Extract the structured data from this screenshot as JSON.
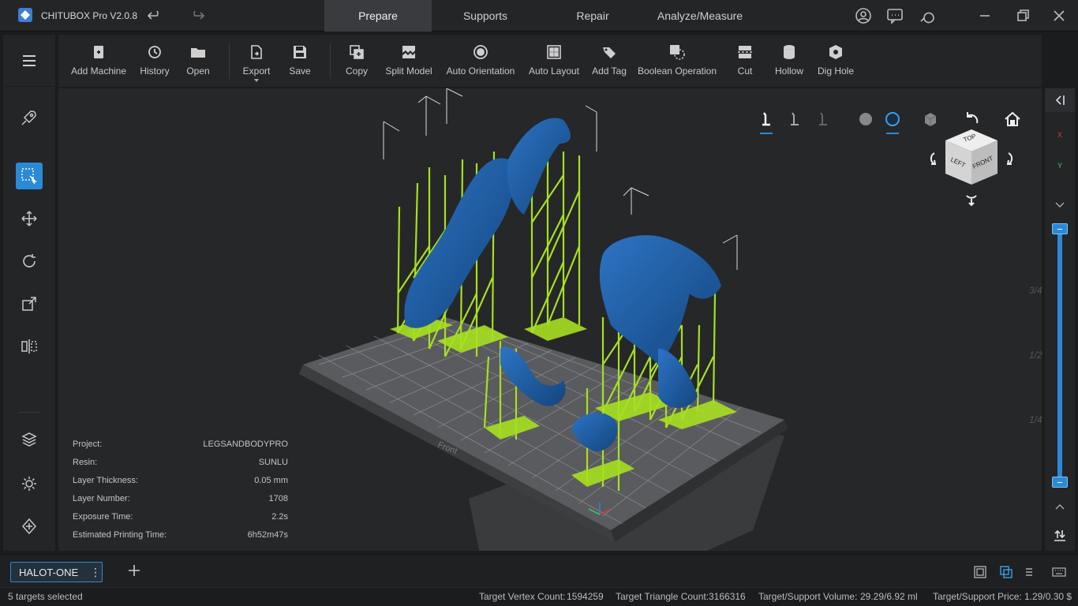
{
  "app": {
    "title": "CHITUBOX Pro V2.0.8"
  },
  "tabs": [
    {
      "label": "Prepare",
      "active": true
    },
    {
      "label": "Supports",
      "active": false
    },
    {
      "label": "Repair",
      "active": false
    },
    {
      "label": "Analyze/Measure",
      "active": false
    }
  ],
  "toolbar": [
    {
      "label": "Add Machine",
      "icon": "add-machine-icon"
    },
    {
      "label": "History",
      "icon": "history-icon"
    },
    {
      "label": "Open",
      "icon": "folder-icon"
    },
    {
      "label": "Export",
      "icon": "export-icon"
    },
    {
      "label": "Save",
      "icon": "save-icon"
    },
    {
      "label": "Copy",
      "icon": "copy-icon"
    },
    {
      "label": "Split Model",
      "icon": "split-model-icon"
    },
    {
      "label": "Auto Orientation",
      "icon": "auto-orientation-icon"
    },
    {
      "label": "Auto Layout",
      "icon": "auto-layout-icon"
    },
    {
      "label": "Add Tag",
      "icon": "tag-icon"
    },
    {
      "label": "Boolean Operation",
      "icon": "boolean-icon"
    },
    {
      "label": "Cut",
      "icon": "cut-icon"
    },
    {
      "label": "Hollow",
      "icon": "hollow-icon"
    },
    {
      "label": "Dig Hole",
      "icon": "dig-hole-icon"
    }
  ],
  "viewcube": {
    "top": "TOP",
    "left": "LEFT",
    "front": "FRONT"
  },
  "plate_label": "Front",
  "info": {
    "rows": [
      {
        "label": "Project:",
        "value": "LEGSANDBODYPRO"
      },
      {
        "label": "Resin:",
        "value": "SUNLU"
      },
      {
        "label": "Layer Thickness:",
        "value": "0.05 mm"
      },
      {
        "label": "Layer Number:",
        "value": "1708"
      },
      {
        "label": "Exposure Time:",
        "value": "2.2s"
      },
      {
        "label": "Estimated Printing Time:",
        "value": "6h52m47s"
      }
    ]
  },
  "right_rail": {
    "axis_x": "X",
    "axis_y": "Y",
    "ticks": [
      "3/4",
      "1/2",
      "1/4"
    ]
  },
  "machine_tab": {
    "label": "HALOT-ONE",
    "more": "⋮"
  },
  "status": {
    "selected": "5 targets selected",
    "vertex_label": "Target Vertex Count:",
    "vertex_value": "1594259",
    "triangle_label": "Target Triangle Count:",
    "triangle_value": "3166316",
    "volume_label": "Target/Support Volume:",
    "volume_value": "29.29/6.92 ml",
    "price_label": "Target/Support Price:",
    "price_value": "1.29/0.30 $"
  },
  "colors": {
    "accent": "#2a8ad6",
    "model": "#1f5fa8",
    "support": "#a6e021"
  }
}
